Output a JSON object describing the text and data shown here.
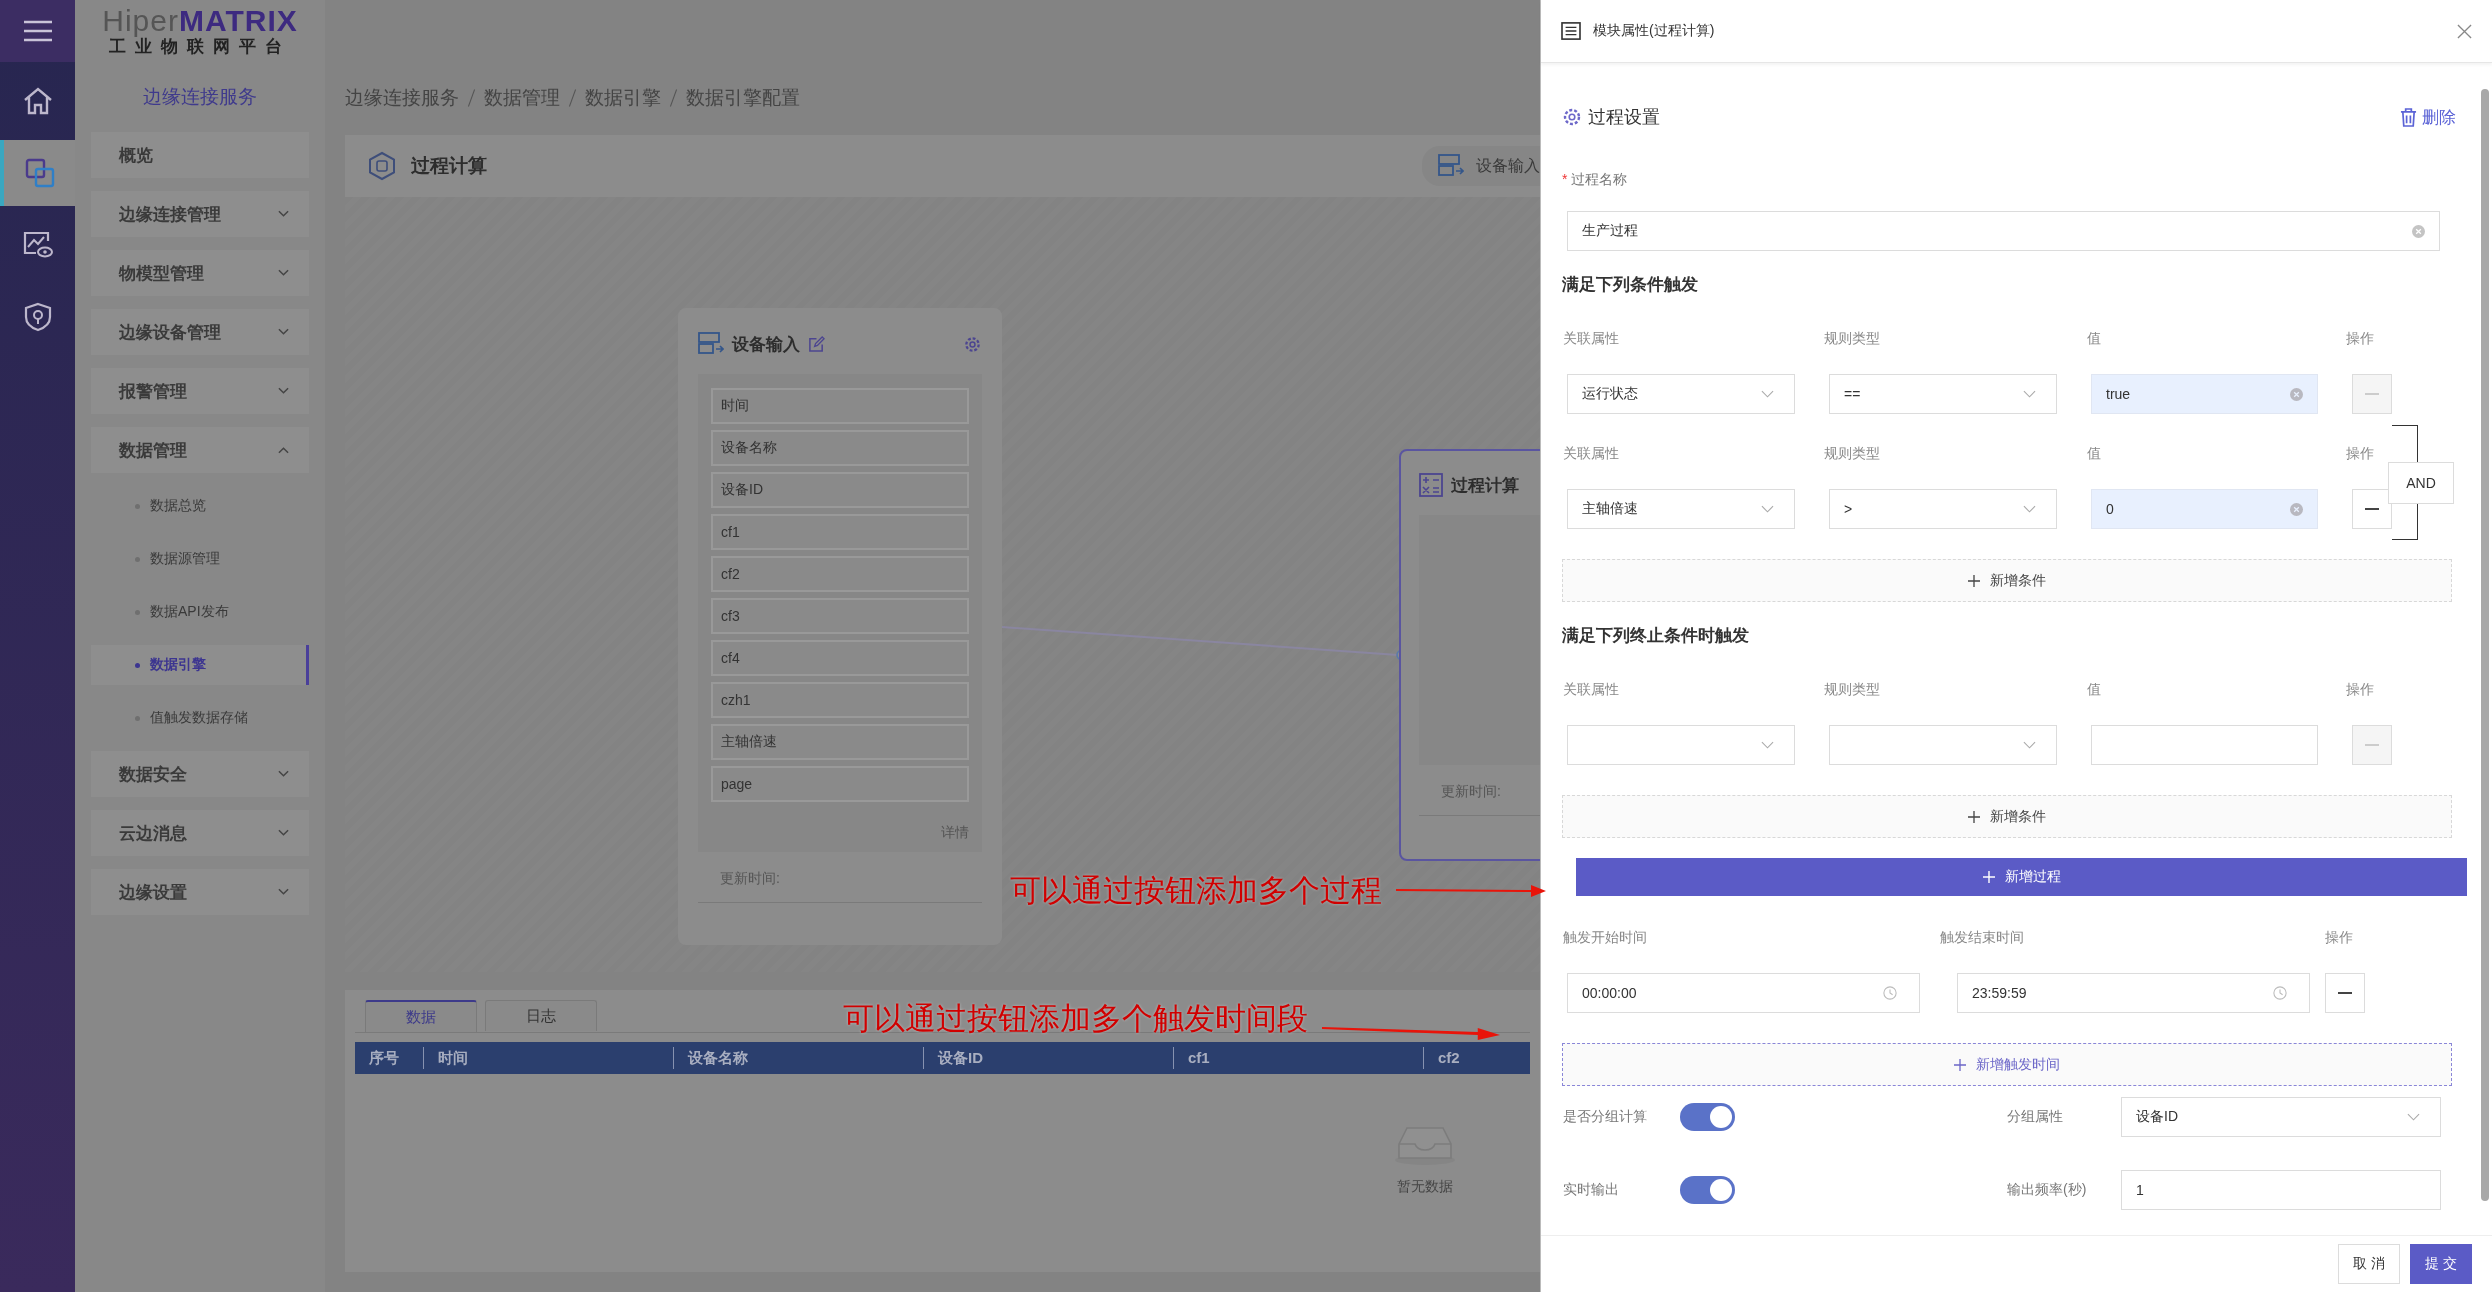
{
  "rail": {
    "items": [
      {
        "kind": "home",
        "selected": false
      },
      {
        "kind": "devices",
        "selected": true
      },
      {
        "kind": "monitor",
        "selected": false
      },
      {
        "kind": "shield",
        "selected": false
      }
    ]
  },
  "logo": {
    "brand_light": "Hiper",
    "brand_bold": "MATRIX",
    "subtitle": "工业物联网平台"
  },
  "sidebar": {
    "title": "边缘连接服务",
    "items": [
      {
        "kind": "link",
        "label": "概览"
      },
      {
        "kind": "group",
        "label": "边缘连接管理",
        "expanded": false
      },
      {
        "kind": "group",
        "label": "物模型管理",
        "expanded": false
      },
      {
        "kind": "group",
        "label": "边缘设备管理",
        "expanded": false
      },
      {
        "kind": "group",
        "label": "报警管理",
        "expanded": false
      },
      {
        "kind": "group",
        "label": "数据管理",
        "expanded": true,
        "children": [
          {
            "label": "数据总览",
            "selected": false
          },
          {
            "label": "数据源管理",
            "selected": false
          },
          {
            "label": "数据API发布",
            "selected": false
          },
          {
            "label": "数据引擎",
            "selected": true
          },
          {
            "label": "值触发数据存储",
            "selected": false
          }
        ]
      },
      {
        "kind": "group",
        "label": "数据安全",
        "expanded": false
      },
      {
        "kind": "group",
        "label": "云边消息",
        "expanded": false
      },
      {
        "kind": "group",
        "label": "边缘设置",
        "expanded": false
      }
    ]
  },
  "breadcrumb": [
    "边缘连接服务",
    "数据管理",
    "数据引擎",
    "数据引擎配置"
  ],
  "toolbar": {
    "title": "过程计算",
    "node_button": "设备输入"
  },
  "canvas": {
    "input_node": {
      "title": "设备输入",
      "fields": [
        "时间",
        "设备名称",
        "设备ID",
        "cf1",
        "cf2",
        "cf3",
        "cf4",
        "czh1",
        "主轴倍速",
        "page"
      ],
      "detail_link": "详情",
      "updated_label": "更新时间:"
    },
    "process_node": {
      "title": "过程计算",
      "updated_label": "更新时间:"
    }
  },
  "bottom_panel": {
    "tabs": [
      {
        "label": "数据",
        "selected": true
      },
      {
        "label": "日志",
        "selected": false
      }
    ],
    "columns": [
      "序号",
      "时间",
      "设备名称",
      "设备ID",
      "cf1",
      "cf2"
    ],
    "empty_text": "暂无数据"
  },
  "annotations": [
    {
      "text": "可以通过按钮添加多个过程"
    },
    {
      "text": "可以通过按钮添加多个触发时间段"
    }
  ],
  "drawer": {
    "title": "模块属性(过程计算)",
    "section_title": "过程设置",
    "delete_label": "删除",
    "required_mark": "*",
    "name_label": "过程名称",
    "name_value": "生产过程",
    "trigger": {
      "title": "满足下列条件触发",
      "logic": "AND",
      "add_label": "新增条件",
      "rows": [
        {
          "labels": [
            "关联属性",
            "规则类型",
            "值",
            "操作"
          ],
          "attribute": "运行状态",
          "rule": "==",
          "value": "true",
          "remove_disabled": true
        },
        {
          "labels": [
            "关联属性",
            "规则类型",
            "值",
            "操作"
          ],
          "attribute": "主轴倍速",
          "rule": ">",
          "value": "0",
          "remove_disabled": false
        }
      ]
    },
    "stop": {
      "title": "满足下列终止条件时触发",
      "add_label": "新增条件",
      "rows": [
        {
          "labels": [
            "关联属性",
            "规则类型",
            "值",
            "操作"
          ],
          "remove_disabled": true
        }
      ]
    },
    "add_process_label": "新增过程",
    "time_ranges": {
      "labels": [
        "触发开始时间",
        "触发结束时间",
        "操作"
      ],
      "rows": [
        {
          "start": "00:00:00",
          "end": "23:59:59",
          "remove_disabled": false
        }
      ],
      "add_label": "新增触发时间"
    },
    "group": {
      "label": "是否分组计算",
      "on": true,
      "attribute_label": "分组属性",
      "attribute_value": "设备ID"
    },
    "realtime": {
      "label": "实时输出",
      "on": true,
      "frequency_label": "输出频率(秒)",
      "frequency_value": "1"
    },
    "buttons": {
      "cancel": "取 消",
      "submit": "提 交"
    }
  }
}
